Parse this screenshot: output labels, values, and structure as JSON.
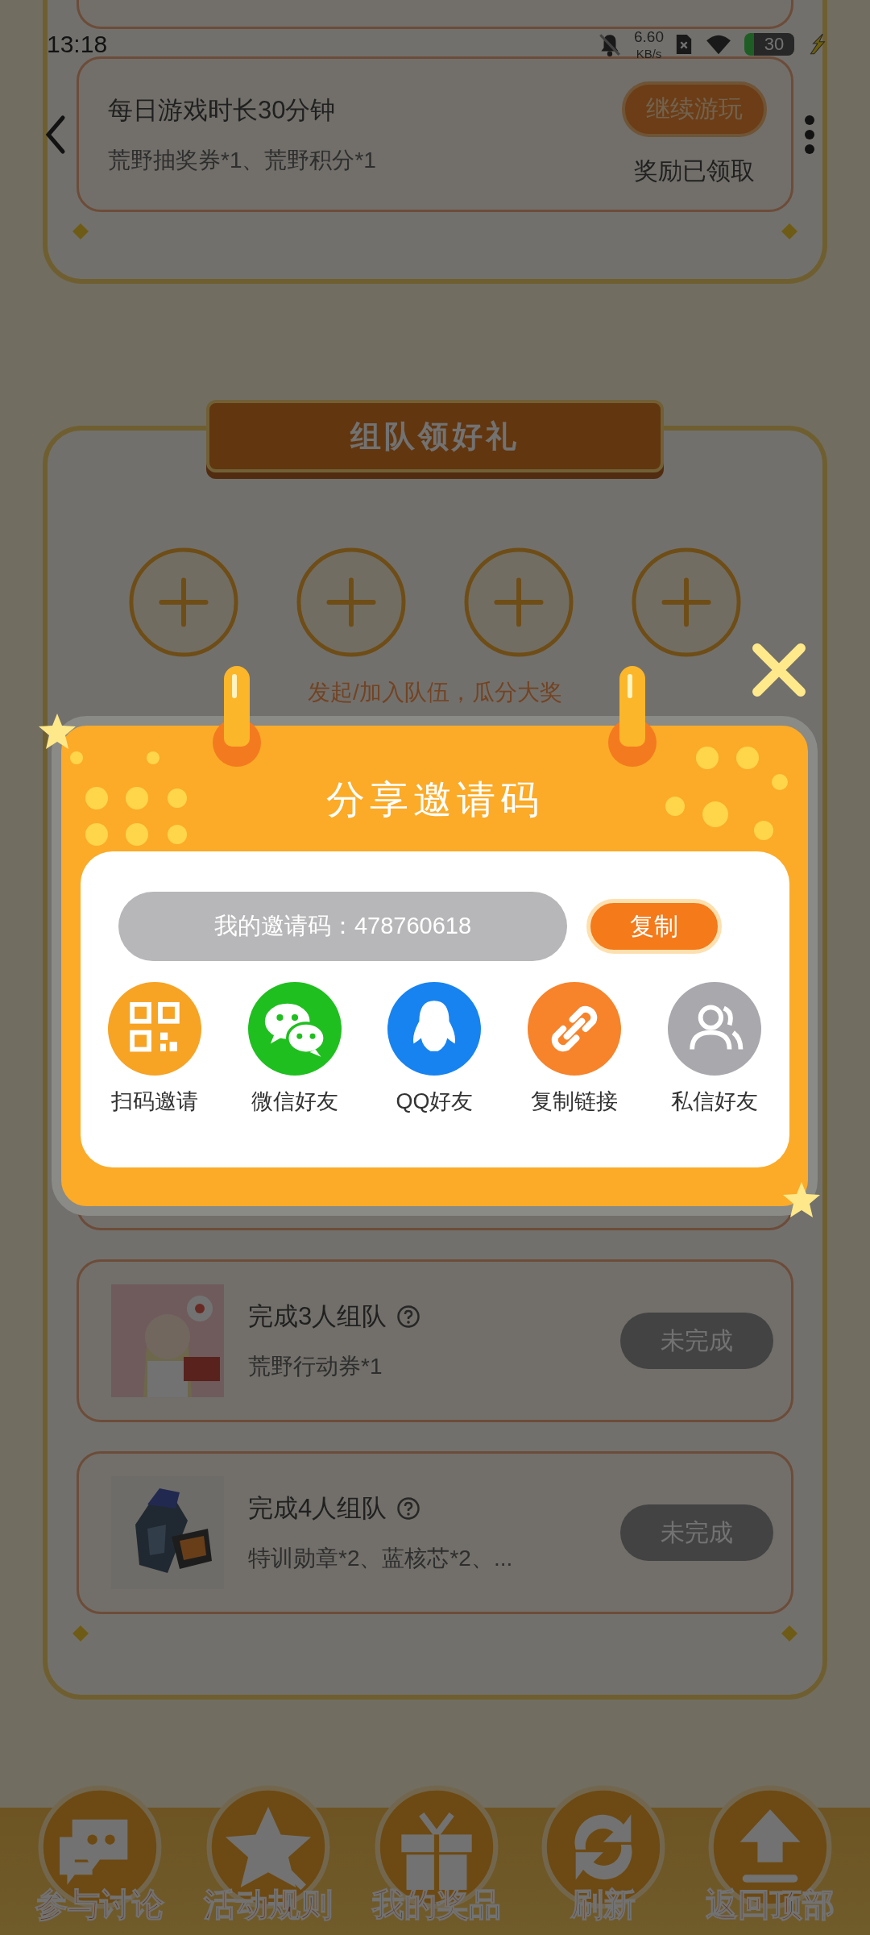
{
  "status_bar": {
    "time": "13:18",
    "net_speed": "6.60",
    "net_unit": "KB/s",
    "battery": "30"
  },
  "daily_task": {
    "title": "每日游戏时长30分钟",
    "rewards": "荒野抽奖券*1、荒野积分*1",
    "button": "继续游玩",
    "status": "奖励已领取"
  },
  "team_panel": {
    "title": "组队领好礼",
    "slots": [
      {
        "kind": "empty"
      },
      {
        "kind": "empty"
      },
      {
        "kind": "empty"
      },
      {
        "kind": "empty"
      }
    ],
    "hint": "发起/加入队伍，瓜分大奖",
    "tasks": [
      {
        "title": "完成3人组队",
        "rewards": "荒野行动券*1",
        "status": "未完成",
        "done": false
      },
      {
        "title": "完成4人组队",
        "rewards": "特训勋章*2、蓝核芯*2、...",
        "status": "未完成",
        "done": false
      }
    ]
  },
  "nav": [
    {
      "label": "参与讨论",
      "kind": "chat"
    },
    {
      "label": "活动规则",
      "kind": "star"
    },
    {
      "label": "我的奖品",
      "kind": "gift"
    },
    {
      "label": "刷新",
      "kind": "refresh"
    },
    {
      "label": "返回顶部",
      "kind": "top"
    }
  ],
  "dialog": {
    "title": "分享邀请码",
    "code": "我的邀请码：478760618",
    "copy_button": "复制",
    "share": [
      {
        "label": "扫码邀请",
        "kind": "qr"
      },
      {
        "label": "微信好友",
        "kind": "wechat"
      },
      {
        "label": "QQ好友",
        "kind": "qq"
      },
      {
        "label": "复制链接",
        "kind": "link"
      },
      {
        "label": "私信好友",
        "kind": "friends"
      }
    ]
  }
}
